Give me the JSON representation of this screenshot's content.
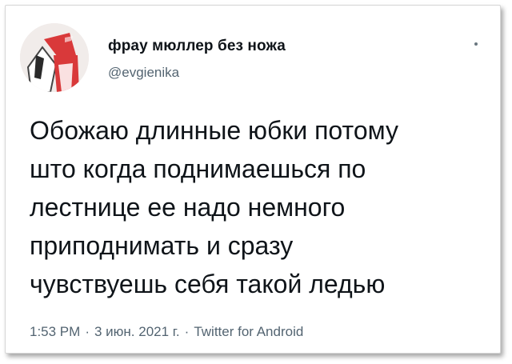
{
  "tweet": {
    "author": {
      "display_name": "фрау мюллер без ножа",
      "handle": "@evgienika",
      "avatar_icon": "avatar-image"
    },
    "text_lines": [
      "Обожаю длинные юбки потому",
      "што когда поднимаешься по",
      "лестнице ее надо немного",
      "приподнимать и сразу",
      "чувствуешь себя такой ледью"
    ],
    "time": "1:53 PM",
    "date": "3 июн. 2021 г.",
    "source": "Twitter for Android",
    "separator": "·",
    "more_icon": "more-options-icon"
  },
  "colors": {
    "text": "#0f1419",
    "muted": "#536471",
    "avatar_accent": "#d9393a"
  }
}
